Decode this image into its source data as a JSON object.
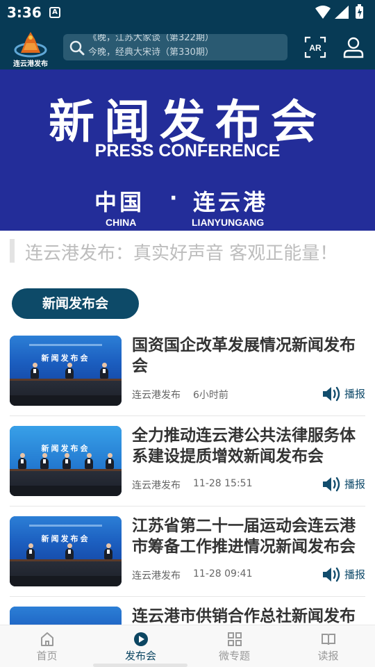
{
  "status_bar": {
    "time": "3:36",
    "notification": "A"
  },
  "header": {
    "logo_text": "连云港发布",
    "search_rolls": [
      "《晚，江苏大家谈（第322期）",
      "今晚，经典大宋诗（第330期）"
    ],
    "ar_label": "AR"
  },
  "banner": {
    "title": "新闻发布会",
    "subtitle": "PRESS CONFERENCE",
    "china_cn": "中国",
    "dot": "·",
    "city_cn": "连云港",
    "china_en": "CHINA",
    "city_en": "LIANYUNGANG"
  },
  "slogan": "连云港发布：真实好声音  客观正能量！",
  "section": {
    "title": "新闻发布会"
  },
  "news": [
    {
      "title": "国资国企改革发展情况新闻发布会",
      "source": "连云港发布",
      "time": "6小时前",
      "play_label": "播报",
      "thumb_text": "新闻发布会"
    },
    {
      "title": "全力推动连云港公共法律服务体系建设提质增效新闻发布会",
      "source": "连云港发布",
      "time": "11-28 15:51",
      "play_label": "播报",
      "thumb_text": "新闻发布会"
    },
    {
      "title": "江苏省第二十一届运动会连云港市筹备工作推进情况新闻发布会",
      "source": "连云港发布",
      "time": "11-28 09:41",
      "play_label": "播报",
      "thumb_text": "新闻发布会"
    },
    {
      "title": "连云港市供销合作总社新闻发布会",
      "source": "",
      "time": "",
      "play_label": "",
      "thumb_text": ""
    }
  ],
  "bottom_nav": [
    {
      "label": "首页",
      "icon": "home-icon",
      "active": false
    },
    {
      "label": "发布会",
      "icon": "play-circle-icon",
      "active": true
    },
    {
      "label": "微专题",
      "icon": "grid-icon",
      "active": false
    },
    {
      "label": "读报",
      "icon": "book-icon",
      "active": false
    }
  ],
  "colors": {
    "header_bg": "#073a55",
    "banner_bg": "#232d99",
    "accent": "#0d4a68"
  }
}
